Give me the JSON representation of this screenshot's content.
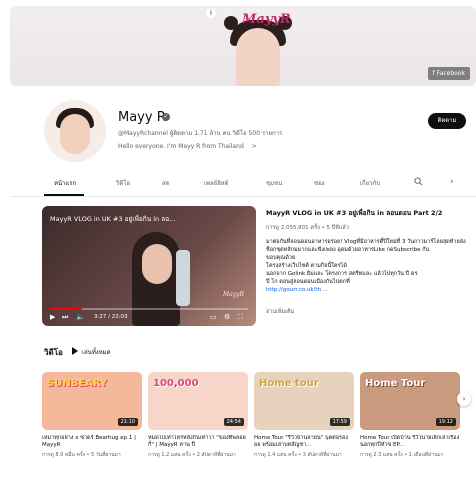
{
  "banner": {
    "logo_text": "MayyR",
    "facebook_label": "Facebook"
  },
  "channel": {
    "name": "Mayy R",
    "meta": "@MayyRchannel  ผู้ติดตาม 1.71 ล้าน คน  วิดีโอ 500 รายการ",
    "description": "Hello everyone. I'm Mayy R from Thailand",
    "description_chevron": ">",
    "subscribe_label": "ติดตาม"
  },
  "tabs": [
    {
      "label": "หน้าแรก"
    },
    {
      "label": "วิดีโอ"
    },
    {
      "label": "สด"
    },
    {
      "label": "เพลย์ลิสต์"
    },
    {
      "label": "ชุมชน"
    },
    {
      "label": "ช่อง"
    },
    {
      "label": "เกี่ยวกับ"
    }
  ],
  "player": {
    "title": "MayyR VLOG in UK #3 อยู่เพื่อกิน in ลอ...",
    "watermark": "MayyR",
    "time": "3:27 / 22:03",
    "progress": 0.16
  },
  "featured": {
    "title": "MayyR VLOG in UK #3 อยู่เพื่อกิน in ลอนดอน Part 2/2",
    "meta": "การดู 2,055,801 ครั้ง • 5 ปีที่แล้ว",
    "description_lines": [
      "มาต่อกันที่ลอนดอนอาหารอร่อย! Vlogที่มีอาหารตี้ปีใหม่ที่ 3 วันกาวมาร์โลยสุดท้ายส่ง",
      "ช็อกชุดหลักมมากและฟังเพลง อุดมด้วยอาหารLike กดSubscribe กัน",
      "ขอบคุณด้วย",
      "โครงสร้างเว็บไซต์ ตามกิจนี้ใครได้",
      "นอกจาก Golink ยิมและ โครงการ สตรีทและ แล้วไปทุกวัน ปี ดร",
      "ปี โก ตอนสู่ลอนดอนเมืองกันไปตกที่"
    ],
    "link_text": "http://gourr.co.uk/th ...",
    "more_label": "อ่านเพิ่มเติม"
  },
  "section": {
    "title": "วิดีโอ",
    "play_all_label": "เล่นทั้งหมด"
  },
  "cards": [
    {
      "title": "เหมาทุกอย่าง x ซาดร์ Bearhug ep.1 | MayyR",
      "meta": "การดู 8.9 หมื่น ครั้ง • 5 วันที่ผ่านมา",
      "duration": "21:10",
      "overlay": "SUNBEARY",
      "bg": "#f4b89b"
    },
    {
      "title": "หมดไปเท่าไหร่หลังกินเท่าวา \"ของที่พลอยกี่\" | MayyR หาน ปี",
      "meta": "การดู 1.2 แสน ครั้ง • 2 สัปดาห์ที่ผ่านมา",
      "duration": "24:54",
      "overlay": "100,000",
      "bg": "#f7d6c9"
    },
    {
      "title": "Home Tour \"รีวิวบ้านลายน\" บุคต่อรองยอ พร้อมเล่าบทสัญชา...",
      "meta": "การดู 1.4 แสน ครั้ง • 3 สัปดาห์ที่ผ่านมา",
      "duration": "17:59",
      "overlay": "Home tour",
      "bg": "#e7d2bd"
    },
    {
      "title": "Home Tour เปิดบ้าน รีวิวนายเล็กเล่าเรื่อง นอกทุกปีหัวข EP...",
      "meta": "การดู 2.3 แสน ครั้ง • 1 เดือนที่ผ่านมา",
      "duration": "19:12",
      "overlay": "Home Tour",
      "bg": "#c99a7e"
    }
  ]
}
